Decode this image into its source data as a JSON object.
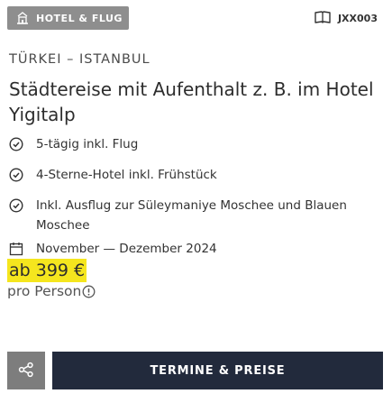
{
  "tag": {
    "label": "HOTEL & FLUG",
    "icon": "hotel-flight-icon",
    "bg_color": "#8e8e8e"
  },
  "code": {
    "label": "JXX003",
    "icon": "book-icon"
  },
  "location": "TÜRKEI – ISTANBUL",
  "title": "Städtereise mit Aufenthalt z. B. im Hotel Yigitalp",
  "features": [
    {
      "icon": "check-circle-icon",
      "text": "5-tägig inkl. Flug"
    },
    {
      "icon": "check-circle-icon",
      "text": "4-Sterne-Hotel inkl. Frühstück"
    },
    {
      "icon": "check-circle-icon",
      "text": "Inkl. Ausflug zur Süleymaniye Moschee und Blauen Moschee"
    }
  ],
  "dates": {
    "icon": "calendar-icon",
    "text": "November — Dezember 2024"
  },
  "price": {
    "label": "ab 399 €",
    "per_person": "pro Person",
    "highlight_color": "#f5e61e"
  },
  "buttons": {
    "share_icon": "share-icon",
    "cta_label": "TERMINE & PREISE",
    "cta_color": "#222a3c"
  }
}
